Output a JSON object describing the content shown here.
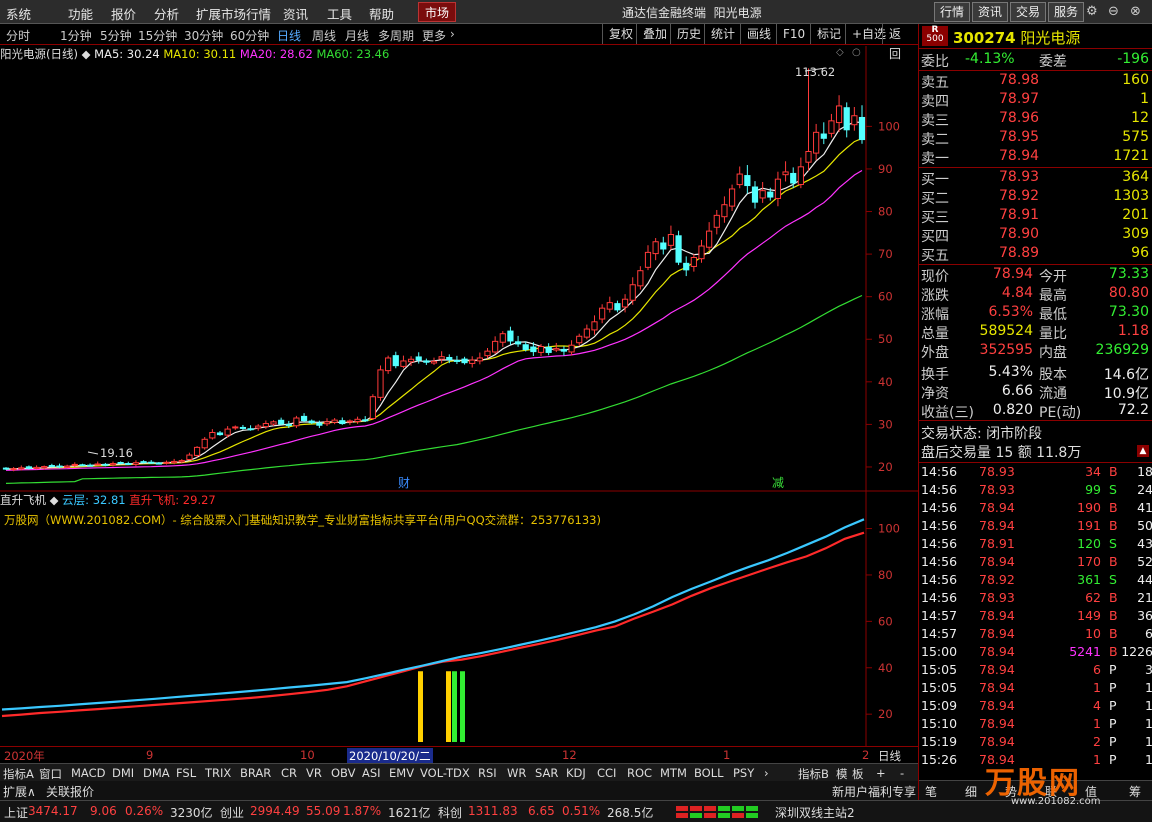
{
  "menu": {
    "items": [
      "系统",
      "功能",
      "报价",
      "分析",
      "扩展市场行情",
      "资讯",
      "工具",
      "帮助"
    ],
    "market_tab": "市场",
    "app_title": "通达信金融终端",
    "stock_title": "阳光电源",
    "right_buttons": [
      "行情",
      "资讯",
      "交易",
      "服务"
    ]
  },
  "periods": {
    "items": [
      "分时",
      "1分钟",
      "5分钟",
      "15分钟",
      "30分钟",
      "60分钟",
      "日线",
      "周线",
      "月线",
      "多周期",
      "更多"
    ],
    "active": "日线",
    "tools": [
      "复权",
      "叠加",
      "历史",
      "统计",
      "画线",
      "F10",
      "标记",
      "+自选",
      "返回"
    ]
  },
  "chart_info": {
    "name": "阳光电源(日线)",
    "ma5": "MA5: 30.24",
    "ma10": "MA10: 30.11",
    "ma20": "MA20: 28.62",
    "ma60": "MA60: 23.46",
    "max_label": "113.62",
    "min_label": "19.16",
    "marker_cai": "财",
    "marker_jian": "减"
  },
  "indicator": {
    "name": "直升飞机",
    "cloud": "云层: 32.81",
    "heli": "直升飞机: 29.27",
    "ad": "万股网（WWW.201082.COM）- 综合股票入门基础知识教学_专业财富指标共享平台(用户QQ交流群：253776133)"
  },
  "xaxis": {
    "labels": [
      "2020年",
      "9",
      "10",
      "2020/10/20/二",
      "12",
      "1",
      "2"
    ],
    "period": "日线"
  },
  "tabs": [
    "指标A",
    "窗口",
    "MACD",
    "DMI",
    "DMA",
    "FSL",
    "TRIX",
    "BRAR",
    "CR",
    "VR",
    "OBV",
    "ASI",
    "EMV",
    "VOL-TDX",
    "RSI",
    "WR",
    "SAR",
    "KDJ",
    "CCI",
    "ROC",
    "MTM",
    "BOLL",
    "PSY"
  ],
  "tabs_right": [
    "指标B",
    "模",
    "板",
    "+",
    "-"
  ],
  "status2": {
    "left": "扩展∧",
    "quote": "关联报价",
    "promo": "新用户福利专享"
  },
  "statusbar": {
    "sh_name": "上证",
    "sh_val": "3474.17",
    "sh_chg": "9.06",
    "sh_pct": "0.26%",
    "sh_amt": "3230亿",
    "cy_name": "创业",
    "cy_val": "2994.49",
    "cy_chg": "55.09",
    "cy_pct": "1.87%",
    "cy_amt": "1621亿",
    "kc_name": "科创",
    "kc_val": "1311.83",
    "kc_chg": "6.65",
    "kc_pct": "0.51%",
    "kc_amt": "268.5亿",
    "server": "深圳双线主站2"
  },
  "quote": {
    "badge_r": "R",
    "badge_num": "500",
    "code": "300274",
    "name": "阳光电源",
    "wb_label": "委比",
    "wb_val": "-4.13%",
    "wc_label": "委差",
    "wc_val": "-196",
    "asks": [
      {
        "label": "卖五",
        "price": "78.98",
        "vol": "160"
      },
      {
        "label": "卖四",
        "price": "78.97",
        "vol": "1"
      },
      {
        "label": "卖三",
        "price": "78.96",
        "vol": "12"
      },
      {
        "label": "卖二",
        "price": "78.95",
        "vol": "575"
      },
      {
        "label": "卖一",
        "price": "78.94",
        "vol": "1721"
      }
    ],
    "bids": [
      {
        "label": "买一",
        "price": "78.93",
        "vol": "364"
      },
      {
        "label": "买二",
        "price": "78.92",
        "vol": "1303"
      },
      {
        "label": "买三",
        "price": "78.91",
        "vol": "201"
      },
      {
        "label": "买四",
        "price": "78.90",
        "vol": "309"
      },
      {
        "label": "买五",
        "price": "78.89",
        "vol": "96"
      }
    ],
    "stats": [
      {
        "l1": "现价",
        "v1": "78.94",
        "l2": "今开",
        "v2": "73.33"
      },
      {
        "l1": "涨跌",
        "v1": "4.84",
        "l2": "最高",
        "v2": "80.80"
      },
      {
        "l1": "涨幅",
        "v1": "6.53%",
        "l2": "最低",
        "v2": "73.30"
      },
      {
        "l1": "总量",
        "v1": "589524",
        "l2": "量比",
        "v2": "1.18"
      },
      {
        "l1": "外盘",
        "v1": "352595",
        "l2": "内盘",
        "v2": "236929"
      },
      {
        "l1": "换手",
        "v1": "5.43%",
        "l2": "股本",
        "v2": "14.6亿"
      },
      {
        "l1": "净资",
        "v1": "6.66",
        "l2": "流通",
        "v2": "10.9亿"
      },
      {
        "l1": "收益(三)",
        "v1": "0.820",
        "l2": "PE(动)",
        "v2": "72.2"
      }
    ],
    "trade_state": "交易状态: 闭市阶段",
    "after_hours": "盘后交易量 15 额 11.8万",
    "ticks": [
      {
        "t": "14:56",
        "p": "78.93",
        "v": "34",
        "d": "B",
        "n": "18"
      },
      {
        "t": "14:56",
        "p": "78.93",
        "v": "99",
        "d": "S",
        "n": "24"
      },
      {
        "t": "14:56",
        "p": "78.94",
        "v": "190",
        "d": "B",
        "n": "41"
      },
      {
        "t": "14:56",
        "p": "78.94",
        "v": "191",
        "d": "B",
        "n": "50"
      },
      {
        "t": "14:56",
        "p": "78.91",
        "v": "120",
        "d": "S",
        "n": "43"
      },
      {
        "t": "14:56",
        "p": "78.94",
        "v": "170",
        "d": "B",
        "n": "52"
      },
      {
        "t": "14:56",
        "p": "78.92",
        "v": "361",
        "d": "S",
        "n": "44"
      },
      {
        "t": "14:56",
        "p": "78.93",
        "v": "62",
        "d": "B",
        "n": "21"
      },
      {
        "t": "14:57",
        "p": "78.94",
        "v": "149",
        "d": "B",
        "n": "36"
      },
      {
        "t": "14:57",
        "p": "78.94",
        "v": "10",
        "d": "B",
        "n": "6"
      },
      {
        "t": "15:00",
        "p": "78.94",
        "v": "5241",
        "d": "B",
        "n": "1226"
      },
      {
        "t": "15:05",
        "p": "78.94",
        "v": "6",
        "d": "P",
        "n": "3"
      },
      {
        "t": "15:05",
        "p": "78.94",
        "v": "1",
        "d": "P",
        "n": "1"
      },
      {
        "t": "15:09",
        "p": "78.94",
        "v": "4",
        "d": "P",
        "n": "1"
      },
      {
        "t": "15:10",
        "p": "78.94",
        "v": "1",
        "d": "P",
        "n": "1"
      },
      {
        "t": "15:19",
        "p": "78.94",
        "v": "2",
        "d": "P",
        "n": "1"
      },
      {
        "t": "15:26",
        "p": "78.94",
        "v": "1",
        "d": "P",
        "n": "1"
      }
    ],
    "bottom_tabs": [
      "笔",
      "细",
      "势",
      "联",
      "值",
      "筹"
    ],
    "watermark": "万股网",
    "watermark_url": "www.201082.com"
  },
  "chart_data": [
    {
      "type": "candlestick",
      "title": "阳光电源(日线)",
      "yticks": [
        20,
        30,
        40,
        50,
        60,
        70,
        80,
        90,
        100
      ],
      "ylim": [
        16,
        117
      ],
      "x": [
        "2020年",
        "9",
        "10",
        "2020/10/20/二",
        "12",
        "1",
        "2"
      ],
      "closes": [
        19.5,
        19.6,
        19.8,
        19.7,
        19.9,
        20.1,
        20.3,
        20.0,
        20.2,
        20.6,
        20.5,
        20.4,
        20.7,
        20.6,
        20.8,
        20.9,
        20.7,
        21.0,
        21.2,
        21.0,
        20.8,
        21.1,
        21.3,
        21.5,
        22.8,
        24.6,
        26.5,
        28.1,
        27.6,
        28.9,
        29.4,
        29.1,
        28.8,
        29.6,
        30.2,
        30.6,
        30.1,
        29.8,
        31.5,
        30.9,
        30.4,
        29.8,
        30.6,
        31.0,
        30.2,
        30.8,
        31.2,
        31.0,
        36.5,
        42.8,
        45.6,
        43.8,
        44.9,
        45.3,
        45.1,
        44.6,
        44.8,
        45.9,
        45.2,
        44.8,
        44.5,
        45.1,
        45.6,
        47.2,
        49.5,
        51.3,
        49.6,
        48.9,
        47.6,
        47.1,
        48.3,
        46.9,
        47.8,
        47.2,
        48.6,
        50.7,
        52.4,
        54.1,
        57.3,
        58.6,
        56.9,
        59.4,
        62.8,
        66.1,
        70.4,
        72.9,
        71.2,
        74.6,
        68.1,
        66.3,
        69.2,
        71.9,
        75.4,
        79.1,
        81.6,
        85.3,
        88.8,
        86.1,
        82.2,
        84.9,
        83.4,
        87.6,
        89.3,
        86.7,
        90.5,
        94.1,
        98.6,
        97.2,
        101.3,
        104.8,
        99.2,
        102.5,
        96.9
      ],
      "ma5_last": 30.24,
      "ma10_last": 30.11,
      "ma20_last": 28.62,
      "ma60_last": 23.46,
      "max": 113.62,
      "min": 19.16
    },
    {
      "type": "line",
      "title": "直升飞机",
      "yticks": [
        20,
        40,
        60,
        80,
        100
      ],
      "ylim": [
        8,
        108
      ],
      "series": [
        {
          "name": "云层",
          "values": [
            22,
            22.5,
            23.1,
            23.6,
            24.2,
            24.8,
            25.4,
            26.0,
            26.6,
            27.3,
            28.0,
            28.6,
            29.3,
            30.0,
            30.7,
            31.5,
            32.2,
            33.0,
            33.8,
            35.5,
            37.3,
            39.2,
            41.0,
            42.9,
            44.8,
            46.3,
            48.0,
            49.8,
            51.6,
            53.5,
            55.5,
            57.5,
            60.0,
            63.0,
            66.5,
            70.5,
            74.0,
            77.2,
            80.5,
            83.5,
            86.3,
            89.5,
            93.0,
            96.5,
            100.5,
            104.0
          ]
        },
        {
          "name": "直升飞机",
          "values": [
            19.2,
            19.8,
            20.5,
            21.0,
            21.6,
            22.2,
            22.8,
            23.4,
            24.0,
            24.6,
            25.2,
            25.8,
            26.4,
            27.0,
            27.8,
            28.6,
            29.5,
            30.5,
            32.0,
            34.2,
            36.4,
            38.6,
            40.8,
            42.6,
            43.5,
            45.0,
            46.7,
            48.5,
            50.2,
            52.0,
            54.0,
            56.0,
            57.8,
            61.2,
            64.2,
            67.3,
            71.0,
            74.3,
            77.2,
            80.0,
            82.8,
            85.5,
            88.0,
            91.5,
            95.6,
            98.2
          ]
        }
      ]
    }
  ]
}
